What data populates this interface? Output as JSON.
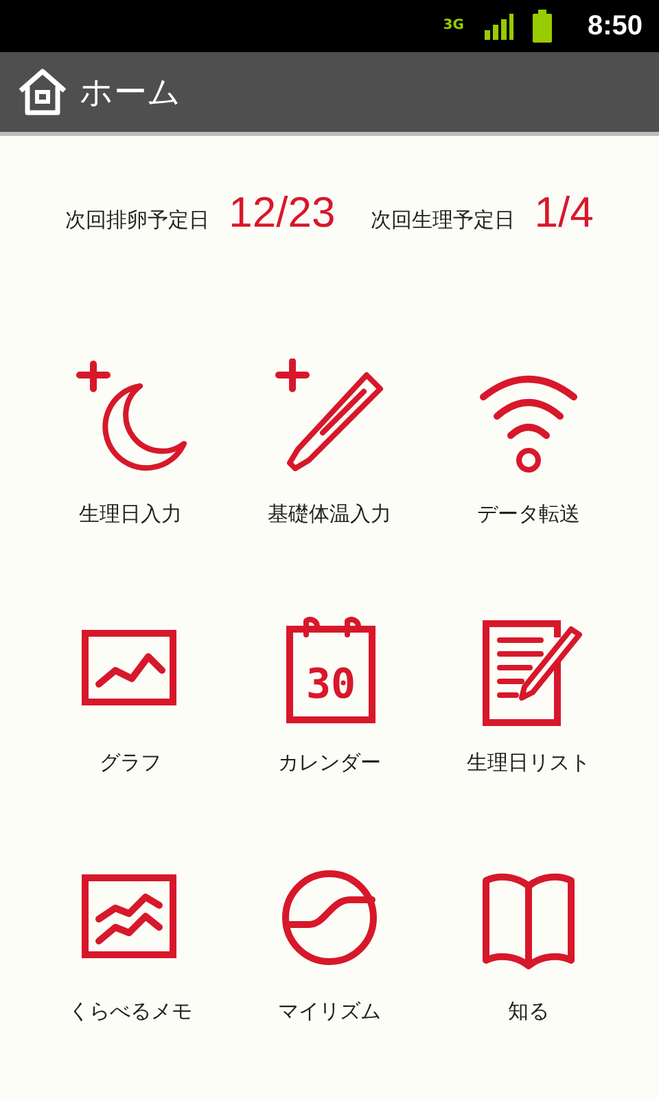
{
  "status_bar": {
    "time": "8:50",
    "network": "3G"
  },
  "app_bar": {
    "title": "ホーム"
  },
  "forecast": [
    {
      "label": "次回排卵予定日",
      "date": "12/23"
    },
    {
      "label": "次回生理予定日",
      "date": "1/4"
    }
  ],
  "menu": [
    {
      "kind": "period-input",
      "label": "生理日入力"
    },
    {
      "kind": "temperature-input",
      "label": "基礎体温入力"
    },
    {
      "kind": "transfer",
      "label": "データ転送"
    },
    {
      "kind": "graph",
      "label": "グラフ"
    },
    {
      "kind": "calendar",
      "label": "カレンダー"
    },
    {
      "kind": "list",
      "label": "生理日リスト"
    },
    {
      "kind": "compare",
      "label": "くらべるメモ"
    },
    {
      "kind": "rhythm",
      "label": "マイリズム"
    },
    {
      "kind": "book",
      "label": "知る"
    }
  ],
  "calendar_icon": {
    "day": "30"
  }
}
